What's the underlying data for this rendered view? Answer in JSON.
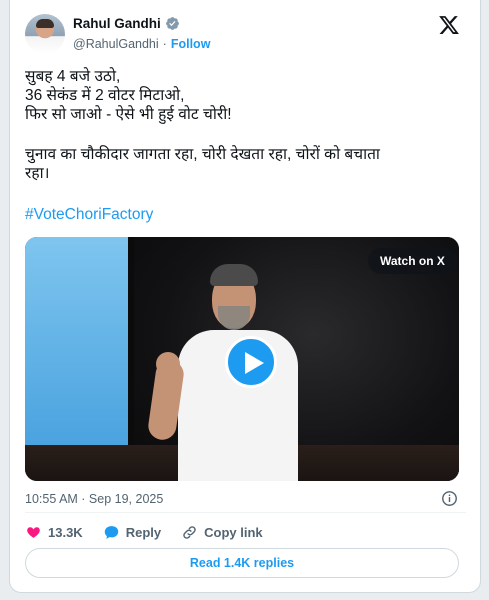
{
  "author": {
    "display_name": "Rahul Gandhi",
    "handle": "@RahulGandhi",
    "separator": "·",
    "follow_label": "Follow"
  },
  "tweet": {
    "lines_para1": [
      "सुबह 4 बजे उठो,",
      "36 सेकंड में 2 वोटर मिटाओ,",
      "फिर सो जाओ - ऐसे भी हुई वोट चोरी!"
    ],
    "para2_line1": "चुनाव का चौकीदार जागता रहा, चोरी देखता रहा, चोरों को बचाता",
    "para2_line2": "रहा।",
    "hashtag": "#VoteChoriFactory"
  },
  "video": {
    "watch_label": "Watch on X"
  },
  "meta": {
    "timestamp": "10:55 AM · Sep 19, 2025"
  },
  "actions": {
    "likes_count": "13.3K",
    "reply_label": "Reply",
    "copy_link_label": "Copy link"
  },
  "read_replies_label": "Read 1.4K replies",
  "colors": {
    "accent": "#1d9bf0",
    "like": "#f91880",
    "text_secondary": "#536471"
  }
}
